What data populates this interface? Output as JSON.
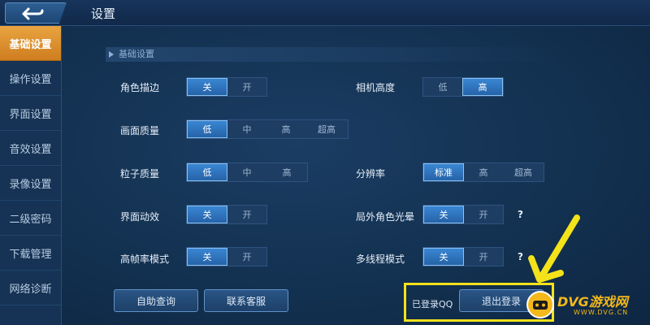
{
  "header": {
    "title": "设置"
  },
  "sidebar": {
    "items": [
      {
        "label": "基础设置",
        "active": true
      },
      {
        "label": "操作设置",
        "active": false
      },
      {
        "label": "界面设置",
        "active": false
      },
      {
        "label": "音效设置",
        "active": false
      },
      {
        "label": "录像设置",
        "active": false
      },
      {
        "label": "二级密码",
        "active": false
      },
      {
        "label": "下载管理",
        "active": false
      },
      {
        "label": "网络诊断",
        "active": false
      }
    ]
  },
  "section": {
    "title": "基础设置"
  },
  "settings": {
    "outline": {
      "label": "角色描边",
      "options": [
        "关",
        "开"
      ],
      "selected": "关"
    },
    "quality": {
      "label": "画面质量",
      "options": [
        "低",
        "中",
        "高",
        "超高"
      ],
      "selected": "低"
    },
    "particles": {
      "label": "粒子质量",
      "options": [
        "低",
        "中",
        "高"
      ],
      "selected": "低"
    },
    "ui_anim": {
      "label": "界面动效",
      "options": [
        "关",
        "开"
      ],
      "selected": "关"
    },
    "hfr": {
      "label": "高帧率模式",
      "options": [
        "关",
        "开"
      ],
      "selected": "关"
    },
    "camera": {
      "label": "相机高度",
      "options": [
        "低",
        "高"
      ],
      "selected": "高"
    },
    "resolution": {
      "label": "分辨率",
      "options": [
        "标准",
        "高",
        "超高"
      ],
      "selected": "标准"
    },
    "halo": {
      "label": "局外角色光晕",
      "options": [
        "关",
        "开"
      ],
      "selected": "关",
      "help": "?"
    },
    "multithread": {
      "label": "多线程模式",
      "options": [
        "关",
        "开"
      ],
      "selected": "关",
      "help": "?"
    }
  },
  "footer": {
    "self_help": "自助查询",
    "support": "联系客服",
    "logged_in": "已登录QQ",
    "logout": "退出登录"
  },
  "watermark": {
    "brand": "DVG游戏网",
    "url": "WWW.DVG.CN"
  },
  "colors": {
    "active_tab": "#e9a440",
    "selected_option": "#3a86d3",
    "highlight": "#f4e21a"
  }
}
